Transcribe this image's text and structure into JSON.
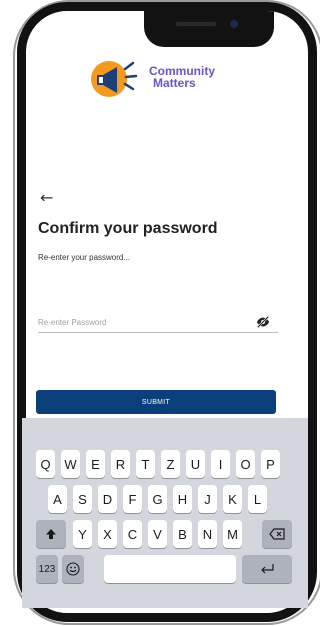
{
  "app": {
    "logo_line1": "Community",
    "logo_line2": "Matters"
  },
  "screen": {
    "title": "Confirm your password",
    "subtitle": "Re-enter your password...",
    "password_field": {
      "placeholder": "Re-enter Password",
      "value": ""
    },
    "submit_label": "SUBMIT"
  },
  "keyboard": {
    "row1": [
      "Q",
      "W",
      "E",
      "R",
      "T",
      "Z",
      "U",
      "I",
      "O",
      "P"
    ],
    "row2": [
      "A",
      "S",
      "D",
      "F",
      "G",
      "H",
      "J",
      "K",
      "L"
    ],
    "row3": [
      "Y",
      "X",
      "C",
      "V",
      "B",
      "N",
      "M"
    ],
    "numbers_label": "123"
  },
  "colors": {
    "primary_button": "#0b3f7a",
    "logo_text": "#6c54c8",
    "logo_orange": "#f39a1f",
    "keyboard_bg": "#d3d6dc"
  }
}
